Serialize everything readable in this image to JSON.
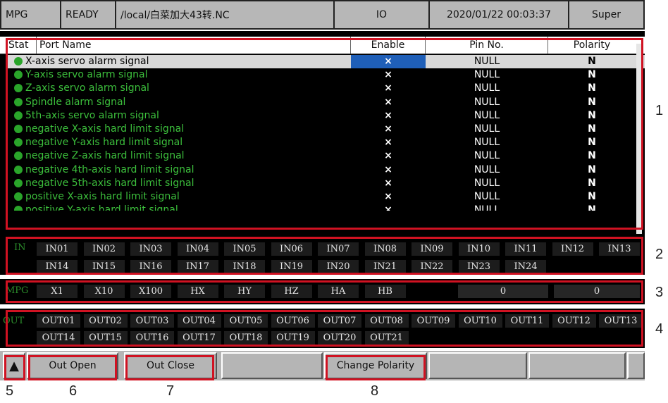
{
  "status_bar": {
    "mode": "MPG",
    "state": "READY",
    "file": "/local/白菜加大43转.NC",
    "screen": "IO",
    "datetime": "2020/01/22 00:03:37",
    "user": "Super"
  },
  "table": {
    "headers": {
      "stat": "Stat",
      "port_name": "Port Name",
      "enable": "Enable",
      "pin": "Pin No.",
      "polarity": "Polarity"
    },
    "rows": [
      {
        "name": "X-axis servo alarm signal",
        "enable": "×",
        "pin": "NULL",
        "polarity": "N",
        "selected": true
      },
      {
        "name": "Y-axis servo alarm signal",
        "enable": "×",
        "pin": "NULL",
        "polarity": "N"
      },
      {
        "name": "Z-axis servo alarm signal",
        "enable": "×",
        "pin": "NULL",
        "polarity": "N"
      },
      {
        "name": "Spindle alarm signal",
        "enable": "×",
        "pin": "NULL",
        "polarity": "N"
      },
      {
        "name": "5th-axis servo alarm signal",
        "enable": "×",
        "pin": "NULL",
        "polarity": "N"
      },
      {
        "name": "negative X-axis hard limit signal",
        "enable": "×",
        "pin": "NULL",
        "polarity": "N"
      },
      {
        "name": "negative Y-axis hard limit signal",
        "enable": "×",
        "pin": "NULL",
        "polarity": "N"
      },
      {
        "name": "negative Z-axis hard limit signal",
        "enable": "×",
        "pin": "NULL",
        "polarity": "N"
      },
      {
        "name": "negative 4th-axis hard limit signal",
        "enable": "×",
        "pin": "NULL",
        "polarity": "N"
      },
      {
        "name": "negative 5th-axis hard limit signal",
        "enable": "×",
        "pin": "NULL",
        "polarity": "N"
      },
      {
        "name": "positive X-axis hard limit signal",
        "enable": "×",
        "pin": "NULL",
        "polarity": "N"
      },
      {
        "name": "positive Y-axis hard limit signal",
        "enable": "×",
        "pin": "NULL",
        "polarity": "N"
      }
    ]
  },
  "inputs": {
    "label": "IN",
    "row1": [
      "IN01",
      "IN02",
      "IN03",
      "IN04",
      "IN05",
      "IN06",
      "IN07",
      "IN08",
      "IN09",
      "IN10",
      "IN11",
      "IN12",
      "IN13"
    ],
    "row2": [
      "IN14",
      "IN15",
      "IN16",
      "IN17",
      "IN18",
      "IN19",
      "IN20",
      "IN21",
      "IN22",
      "IN23",
      "IN24"
    ]
  },
  "mpg": {
    "label": "MPG",
    "keys": [
      "X1",
      "X10",
      "X100",
      "HX",
      "HY",
      "HZ",
      "HA",
      "HB"
    ],
    "value1": "0",
    "value2": "0"
  },
  "outputs": {
    "label": "OUT",
    "row1": [
      "OUT01",
      "OUT02",
      "OUT03",
      "OUT04",
      "OUT05",
      "OUT06",
      "OUT07",
      "OUT08",
      "OUT09",
      "OUT10",
      "OUT11",
      "OUT12",
      "OUT13"
    ],
    "row2": [
      "OUT14",
      "OUT15",
      "OUT16",
      "OUT17",
      "OUT18",
      "OUT19",
      "OUT20",
      "OUT21"
    ]
  },
  "softkeys": {
    "up": "▲",
    "out_open": "Out Open",
    "out_close": "Out Close",
    "change_polarity": "Change Polarity"
  },
  "callouts": [
    "1",
    "2",
    "3",
    "4",
    "5",
    "6",
    "7",
    "8"
  ],
  "colors": {
    "active_green": "#3cbf3c",
    "highlight_blue": "#1f5fb8",
    "annotation_red": "#d01222"
  }
}
